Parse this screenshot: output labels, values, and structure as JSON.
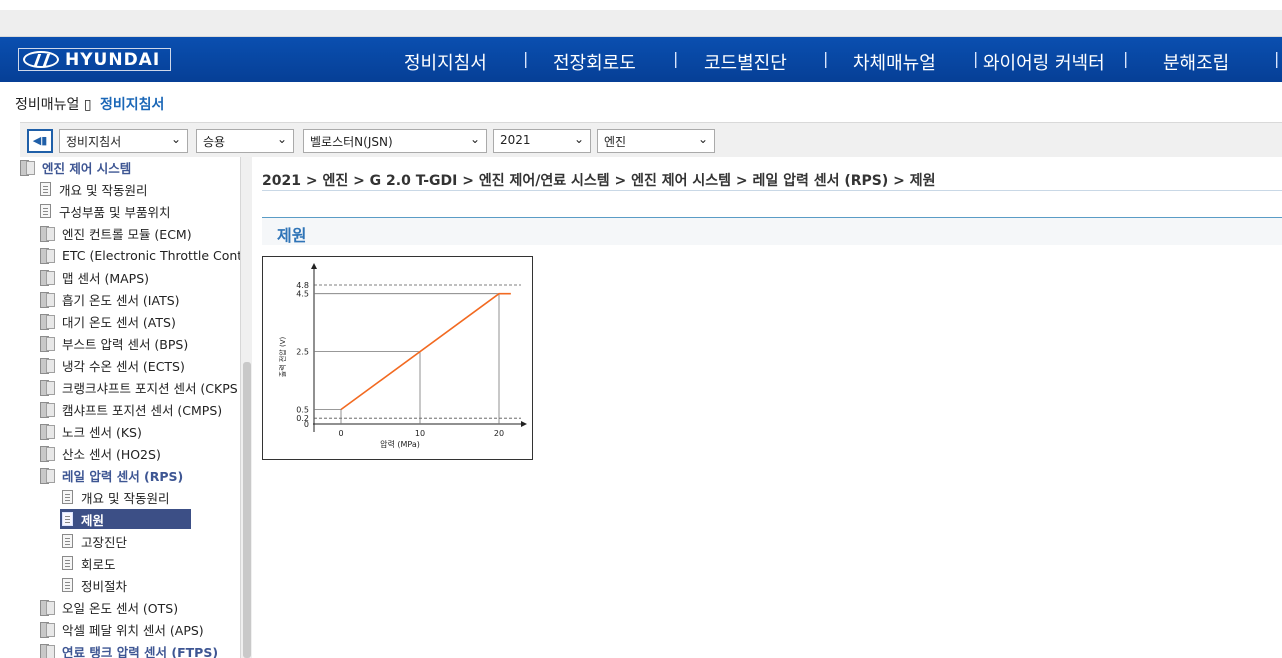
{
  "header": {
    "brand": "HYUNDAI",
    "nav": [
      "정비지침서",
      "전장회로도",
      "코드별진단",
      "차체매뉴얼",
      "와이어링 커넥터",
      "분해조립"
    ],
    "separator": "|"
  },
  "breadcrumb_top": {
    "root": "정비매뉴얼",
    "arrow": "▯",
    "current": "정비지침서"
  },
  "toolbar": {
    "collapse_icon": "◀▮",
    "selects": [
      "정비지침서",
      "승용",
      "벨로스터N(JSN)",
      "2021",
      "엔진"
    ]
  },
  "tree": [
    {
      "label": "엔진 제어 시스템",
      "icon": "book",
      "level": 0,
      "style": "bold-blue"
    },
    {
      "label": "개요 및 작동원리",
      "icon": "doc",
      "level": 1
    },
    {
      "label": "구성부품 및 부품위치",
      "icon": "doc",
      "level": 1
    },
    {
      "label": "엔진 컨트롤 모듈 (ECM)",
      "icon": "book",
      "level": 1
    },
    {
      "label": "ETC (Electronic Throttle Control",
      "icon": "book",
      "level": 1
    },
    {
      "label": "맵 센서 (MAPS)",
      "icon": "book",
      "level": 1
    },
    {
      "label": "흡기 온도 센서 (IATS)",
      "icon": "book",
      "level": 1
    },
    {
      "label": "대기 온도 센서 (ATS)",
      "icon": "book",
      "level": 1
    },
    {
      "label": "부스트 압력 센서 (BPS)",
      "icon": "book",
      "level": 1
    },
    {
      "label": "냉각 수온 센서 (ECTS)",
      "icon": "book",
      "level": 1
    },
    {
      "label": "크랭크샤프트 포지션 센서 (CKPS",
      "icon": "book",
      "level": 1
    },
    {
      "label": "캠샤프트 포지션 센서 (CMPS)",
      "icon": "book",
      "level": 1
    },
    {
      "label": "노크 센서 (KS)",
      "icon": "book",
      "level": 1
    },
    {
      "label": "산소 센서 (HO2S)",
      "icon": "book",
      "level": 1
    },
    {
      "label": "레일 압력 센서 (RPS)",
      "icon": "book",
      "level": 1,
      "style": "bold-blue"
    },
    {
      "label": "개요 및 작동원리",
      "icon": "doc",
      "level": 2
    },
    {
      "label": "제원",
      "icon": "doc",
      "level": 2,
      "style": "selected"
    },
    {
      "label": "고장진단",
      "icon": "doc",
      "level": 2
    },
    {
      "label": "회로도",
      "icon": "doc",
      "level": 2
    },
    {
      "label": "정비절차",
      "icon": "doc",
      "level": 2
    },
    {
      "label": "오일 온도 센서 (OTS)",
      "icon": "book",
      "level": 1
    },
    {
      "label": "악셀 페달 위치 센서 (APS)",
      "icon": "book",
      "level": 1
    },
    {
      "label": "연료 탱크 압력 센서 (FTPS)",
      "icon": "book",
      "level": 1,
      "style": "bold-blue"
    }
  ],
  "content": {
    "path": "2021 > 엔진 > G 2.0 T-GDI > 엔진 제어/연료 시스템 > 엔진 제어 시스템 > 레일 압력 센서 (RPS) > 제원",
    "section_title": "제원"
  },
  "chart_data": {
    "type": "line",
    "title": "",
    "xlabel": "압력 (MPa)",
    "ylabel": "출력 전압 (V)",
    "x_ticks": [
      0,
      10,
      20
    ],
    "y_ticks": [
      0,
      0.2,
      0.5,
      2.5,
      4.5,
      4.8
    ],
    "series": [
      {
        "x": [
          0,
          0,
          20,
          21.5
        ],
        "y": [
          0.5,
          0.5,
          4.5,
          4.5
        ]
      }
    ],
    "x_range": [
      -3,
      22
    ],
    "y_range": [
      0,
      5.5
    ],
    "line_color": "#f26a21",
    "grid": "dashed reference lines at 0.2 and 4.8, solid guide lines at 0.5, 2.5, 4.5"
  }
}
